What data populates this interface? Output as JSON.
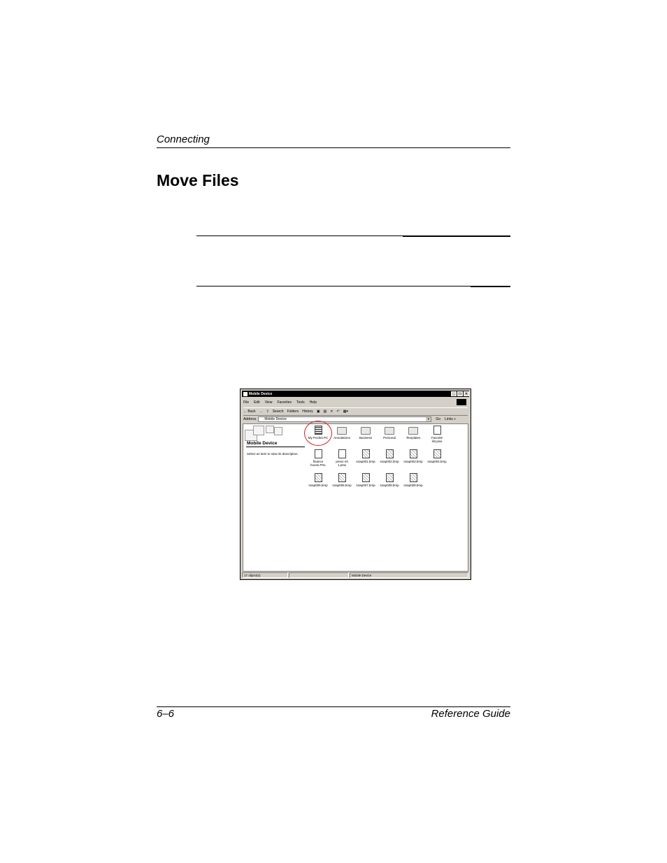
{
  "header": {
    "running_head": "Connecting"
  },
  "section": {
    "title": "Move Files"
  },
  "footer": {
    "page_number": "6–6",
    "guide_title": "Reference Guide"
  },
  "screenshot": {
    "window_title": "Mobile Device",
    "menu": [
      "File",
      "Edit",
      "View",
      "Favorites",
      "Tools",
      "Help"
    ],
    "toolbar": {
      "back": "← Back",
      "search": "Search",
      "folders": "Folders",
      "history": "History"
    },
    "address": {
      "label": "Address",
      "value": "Mobile Device",
      "go": "Go",
      "links": "Links »"
    },
    "left_pane": {
      "title": "Mobile Device",
      "description": "Select an item to view its description."
    },
    "items": [
      {
        "label": "My Pocket PC",
        "kind": "pocket"
      },
      {
        "label": "Annotations",
        "kind": "folder"
      },
      {
        "label": "Business",
        "kind": "folder"
      },
      {
        "label": "Personal",
        "kind": "folder"
      },
      {
        "label": "Templates",
        "kind": "folder"
      },
      {
        "label": "Favorite\nlist.psw",
        "kind": "doc"
      },
      {
        "label": "finance\nhouse.PXL",
        "kind": "doc"
      },
      {
        "label": "press rel\n1.psw",
        "kind": "doc"
      },
      {
        "label": "snap001.bmp",
        "kind": "img"
      },
      {
        "label": "snap002.bmp",
        "kind": "img"
      },
      {
        "label": "snap003.bmp",
        "kind": "img"
      },
      {
        "label": "snap004.bmp",
        "kind": "img"
      },
      {
        "label": "snap005.bmp",
        "kind": "img"
      },
      {
        "label": "snap006.bmp",
        "kind": "img"
      },
      {
        "label": "snap007.bmp",
        "kind": "img"
      },
      {
        "label": "snap008.bmp",
        "kind": "img"
      },
      {
        "label": "snap009.bmp",
        "kind": "img"
      }
    ],
    "status": {
      "count": "17 object(s)",
      "location": "Mobile Device"
    }
  }
}
